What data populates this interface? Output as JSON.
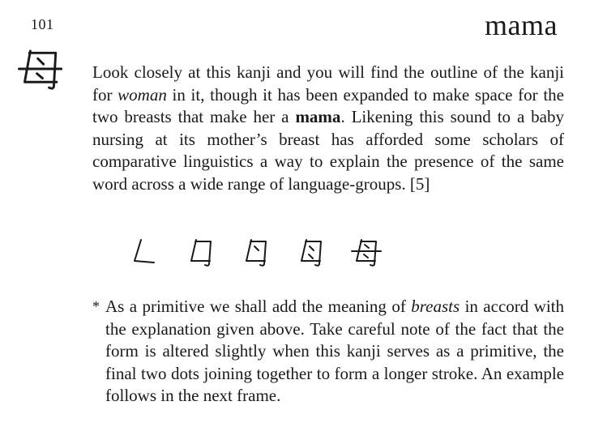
{
  "frame_number": "101",
  "keyword": "mama",
  "kanji_icon": "kanji-mother-glyph",
  "paragraph": {
    "part1": "Look closely at this kanji and you will find the outline of the kanji for ",
    "emph_woman": "woman",
    "part2": " in it, though it has been expanded to make space for the two breasts that make her a ",
    "bold_mama": "mama",
    "part3": ". Likening this sound to a baby nursing at its mother’s breast has afforded some scholars of comparative linguistics a way to explain the presence of the same word across a wide range of language-groups. [5]"
  },
  "stroke_order": {
    "icon": "stroke-order-icon",
    "step_count": 5
  },
  "note": {
    "marker": "*",
    "part1": "As a primitive we shall add the meaning of ",
    "emph_breasts": "breasts",
    "part2": " in accord with the explanation given above. Take careful note of the fact that the form is altered slightly when this kanji serves as a primitive, the final two dots joining together to form a longer stroke. An example follows in the next frame."
  }
}
